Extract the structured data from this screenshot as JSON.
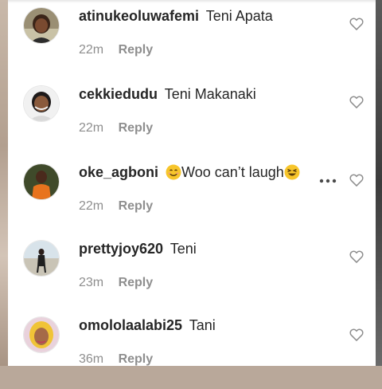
{
  "comments": [
    {
      "username": "atinukeoluwafemi",
      "text": "Teni Apata",
      "time": "22m",
      "reply_label": "Reply",
      "avatar_icon": "avatar-woman-photo",
      "liked": false
    },
    {
      "username": "cekkiedudu",
      "text": "Teni Makanaki",
      "time": "22m",
      "reply_label": "Reply",
      "avatar_icon": "avatar-woman-photo",
      "liked": false
    },
    {
      "username": "oke_agboni",
      "text_prefix_emoji": "smiling-face-emoji",
      "text": "Woo can’t laugh",
      "text_suffix_emoji": "grinning-squinting-face-emoji",
      "time": "22m",
      "reply_label": "Reply",
      "avatar_icon": "avatar-man-photo",
      "liked": false,
      "more_icon": "more-options-icon"
    },
    {
      "username": "prettyjoy620",
      "text": "Teni",
      "time": "23m",
      "reply_label": "Reply",
      "avatar_icon": "avatar-beach-photo",
      "liked": false
    },
    {
      "username": "omololaalabi25",
      "text": "Tani",
      "time": "36m",
      "reply_label": "Reply",
      "avatar_icon": "avatar-woman-photo",
      "liked": false
    }
  ],
  "colors": {
    "text": "#262626",
    "meta": "#8e8e8e",
    "heart_outline": "#8e8e8e",
    "emoji_yellow": "#f7c52b"
  }
}
